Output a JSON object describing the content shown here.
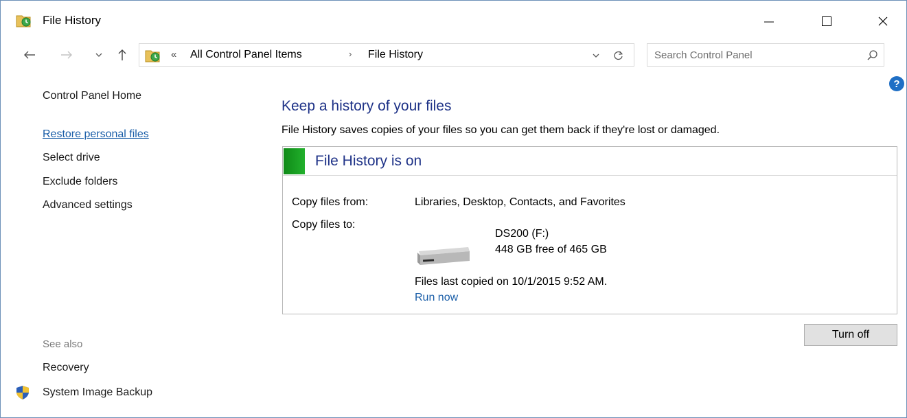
{
  "window": {
    "title": "File History",
    "app_icon": "file-history-icon",
    "controls": {
      "minimize": "minimize-icon",
      "maximize": "maximize-icon",
      "close": "close-icon"
    }
  },
  "nav": {
    "back_icon": "back-arrow-icon",
    "forward_icon": "forward-arrow-icon",
    "recent_icon": "chevron-down-icon",
    "up_icon": "up-arrow-icon",
    "address": {
      "overflow": "«",
      "crumbs": [
        "All Control Panel Items",
        "File History"
      ],
      "separator": "›"
    },
    "search": {
      "placeholder": "Search Control Panel"
    }
  },
  "sidebar": {
    "home": "Control Panel Home",
    "links": [
      "Restore personal files",
      "Select drive",
      "Exclude folders",
      "Advanced settings"
    ],
    "see_also": "See also",
    "see_also_links": [
      "Recovery",
      "System Image Backup"
    ]
  },
  "main": {
    "heading": "Keep a history of your files",
    "description": "File History saves copies of your files so you can get them back if they're lost or damaged.",
    "status": {
      "title": "File History is on",
      "status_color": "#1aa324",
      "copy_from_label": "Copy files from:",
      "copy_from_value": "Libraries, Desktop, Contacts, and Favorites",
      "copy_to_label": "Copy files to:",
      "drive_name": "DS200 (F:)",
      "drive_space": "448 GB free of 465 GB",
      "last_copied": "Files last copied on 10/1/2015 9:52 AM.",
      "run_now": "Run now"
    },
    "turn_off": "Turn off"
  },
  "help_icon": "?",
  "colors": {
    "link": "#1a5ea8",
    "heading": "#1e3287",
    "status_on": "#1aa324"
  }
}
